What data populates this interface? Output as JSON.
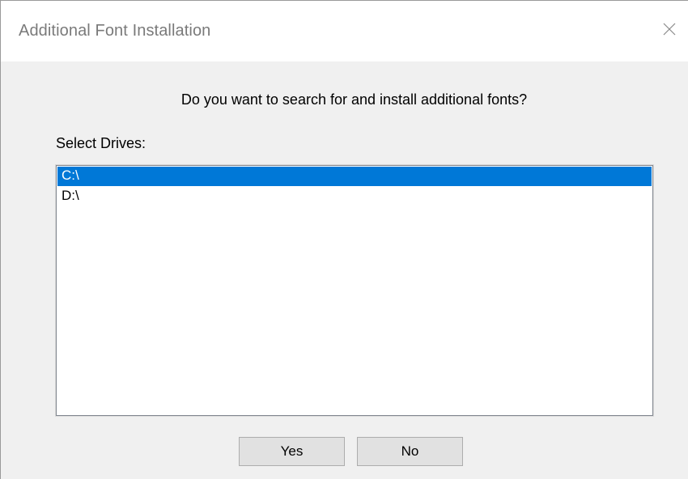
{
  "window": {
    "title": "Additional Font Installation",
    "close_icon": "close-icon"
  },
  "content": {
    "question": "Do you want to search for and install additional fonts?",
    "drives_label": "Select Drives:",
    "drives": [
      {
        "label": "C:\\",
        "selected": true
      },
      {
        "label": "D:\\",
        "selected": false
      }
    ]
  },
  "buttons": {
    "yes": "Yes",
    "no": "No"
  },
  "colors": {
    "selection": "#0078d7",
    "dialog_bg": "#f0f0f0"
  }
}
